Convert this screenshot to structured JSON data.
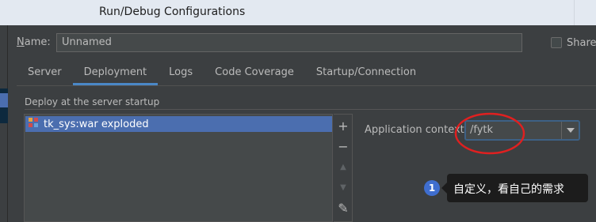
{
  "window": {
    "title": "Run/Debug Configurations"
  },
  "name_row": {
    "label_mnemonic": "N",
    "label_rest": "ame:",
    "value": "Unnamed",
    "share_label": "Share",
    "share_checked": false
  },
  "tabs": [
    {
      "label": "Server",
      "active": false
    },
    {
      "label": "Deployment",
      "active": true
    },
    {
      "label": "Logs",
      "active": false
    },
    {
      "label": "Code Coverage",
      "active": false
    },
    {
      "label": "Startup/Connection",
      "active": false
    }
  ],
  "deployment": {
    "group_title": "Deploy at the server startup",
    "artifacts": [
      {
        "label": "tk_sys:war exploded",
        "icon": "artifact-icon",
        "selected": true
      }
    ],
    "toolbar": [
      {
        "name": "add-icon",
        "glyph": "+",
        "enabled": true
      },
      {
        "name": "remove-icon",
        "glyph": "−",
        "enabled": true
      },
      {
        "name": "move-up-icon",
        "glyph": "▲",
        "enabled": false
      },
      {
        "name": "move-down-icon",
        "glyph": "▼",
        "enabled": false
      },
      {
        "name": "edit-icon",
        "glyph": "✎",
        "enabled": true
      }
    ],
    "context_label": "Application context:",
    "context_value": "/fytk"
  },
  "annotation": {
    "number": "1",
    "text": "自定义，看自己的需求",
    "highlight_color": "#e02020"
  },
  "colors": {
    "background": "#3c3f41",
    "selection": "#4b6eaf",
    "tab_underline": "#4a88c7",
    "badge": "#3f6ecf"
  }
}
